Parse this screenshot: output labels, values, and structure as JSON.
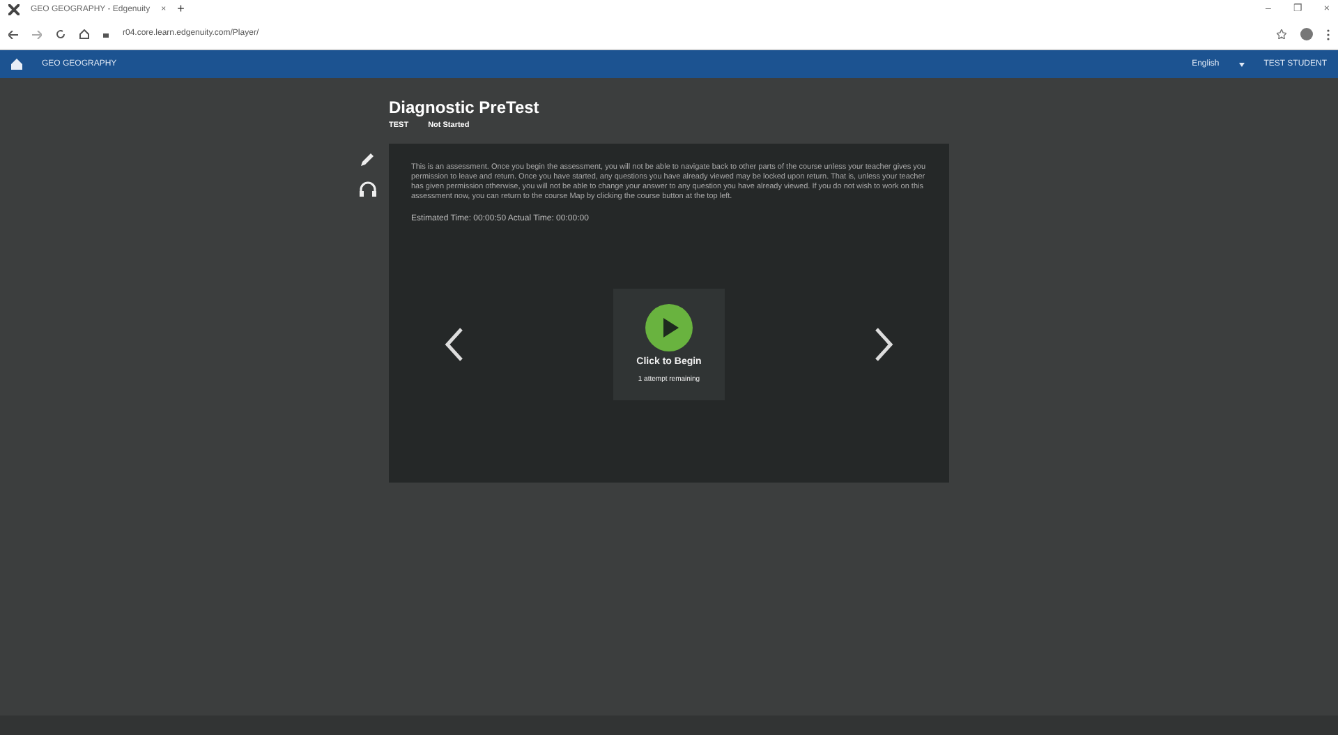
{
  "browser": {
    "tab_title": "GEO GEOGRAPHY - Edgenuity",
    "tab_close": "×",
    "new_tab": "+",
    "url": "r04.core.learn.edgenuity.com/Player/",
    "window_controls": [
      "–",
      "❐",
      "×"
    ]
  },
  "navbar": {
    "course": "GEO GEOGRAPHY",
    "language": "English",
    "user": "TEST STUDENT"
  },
  "activity": {
    "title": "Diagnostic PreTest",
    "type": "TEST",
    "status": "Not Started"
  },
  "tools": [
    {
      "kind": "pencil"
    },
    {
      "kind": "headphones"
    }
  ],
  "panel": {
    "instructions": "This is an assessment. Once you begin the assessment, you will not be able to navigate back to other parts of the course unless your teacher gives you permission to leave and return. Once you have started, any questions you have already viewed may be locked upon return. That is, unless your teacher has given permission otherwise, you will not be able to change your answer to any question you have already viewed. If you do not wish to work on this assessment now, you can return to the course Map by clicking the course button at the top left.",
    "time": "Estimated Time: 00:00:50 Actual Time: 00:00:00",
    "start_label": "Click to Begin",
    "attempts": "1 attempt remaining"
  }
}
